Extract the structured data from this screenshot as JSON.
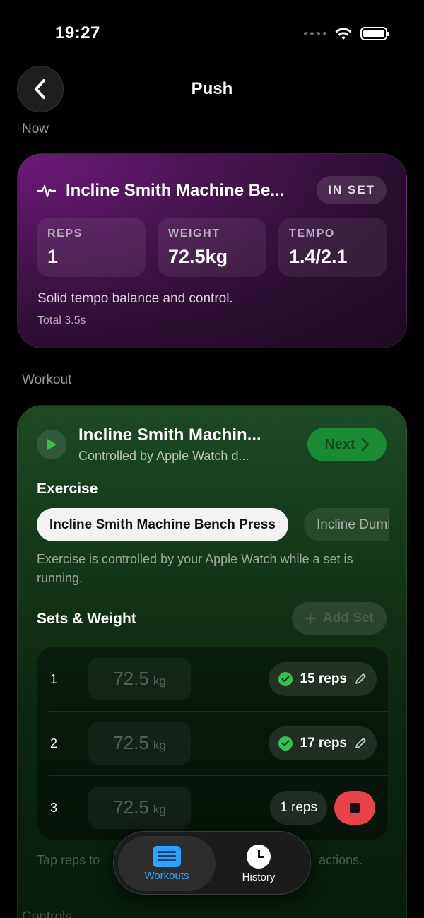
{
  "status": {
    "time": "19:27"
  },
  "nav": {
    "title": "Push"
  },
  "now": {
    "section_label": "Now",
    "exercise_title": "Incline Smith Machine Be...",
    "state_badge": "IN SET",
    "metrics": [
      {
        "label": "REPS",
        "value": "1"
      },
      {
        "label": "WEIGHT",
        "value": "72.5kg"
      },
      {
        "label": "TEMPO",
        "value": "1.4/2.1"
      }
    ],
    "description": "Solid tempo balance and control.",
    "total": "Total 3.5s"
  },
  "workout": {
    "section_label": "Workout",
    "title": "Incline Smith Machin...",
    "subtitle": "Controlled by Apple Watch d...",
    "next_label": "Next",
    "exercise_heading": "Exercise",
    "exercises": [
      "Incline Smith Machine Bench Press",
      "Incline Dumbbell Press"
    ],
    "exercise_note": "Exercise is controlled by your Apple Watch while a set is running.",
    "sets_heading": "Sets & Weight",
    "add_set_label": "Add Set",
    "sets": [
      {
        "number": "1",
        "weight": "72.5",
        "unit": "kg",
        "reps": "15 reps",
        "status": "done"
      },
      {
        "number": "2",
        "weight": "72.5",
        "unit": "kg",
        "reps": "17 reps",
        "status": "done"
      },
      {
        "number": "3",
        "weight": "72.5",
        "unit": "kg",
        "reps": "1 reps",
        "status": "active"
      }
    ],
    "hint_start": "Tap reps to",
    "hint_end": "actions."
  },
  "controls_label": "Controls",
  "tabs": [
    {
      "label": "Workouts",
      "icon": "list-icon",
      "active": true
    },
    {
      "label": "History",
      "icon": "clock-icon",
      "active": false
    }
  ],
  "colors": {
    "accent_blue": "#2aa3ff",
    "accent_green": "#1b8a34",
    "stop_red": "#e8434b",
    "now_purple": "#6d1a7a"
  }
}
